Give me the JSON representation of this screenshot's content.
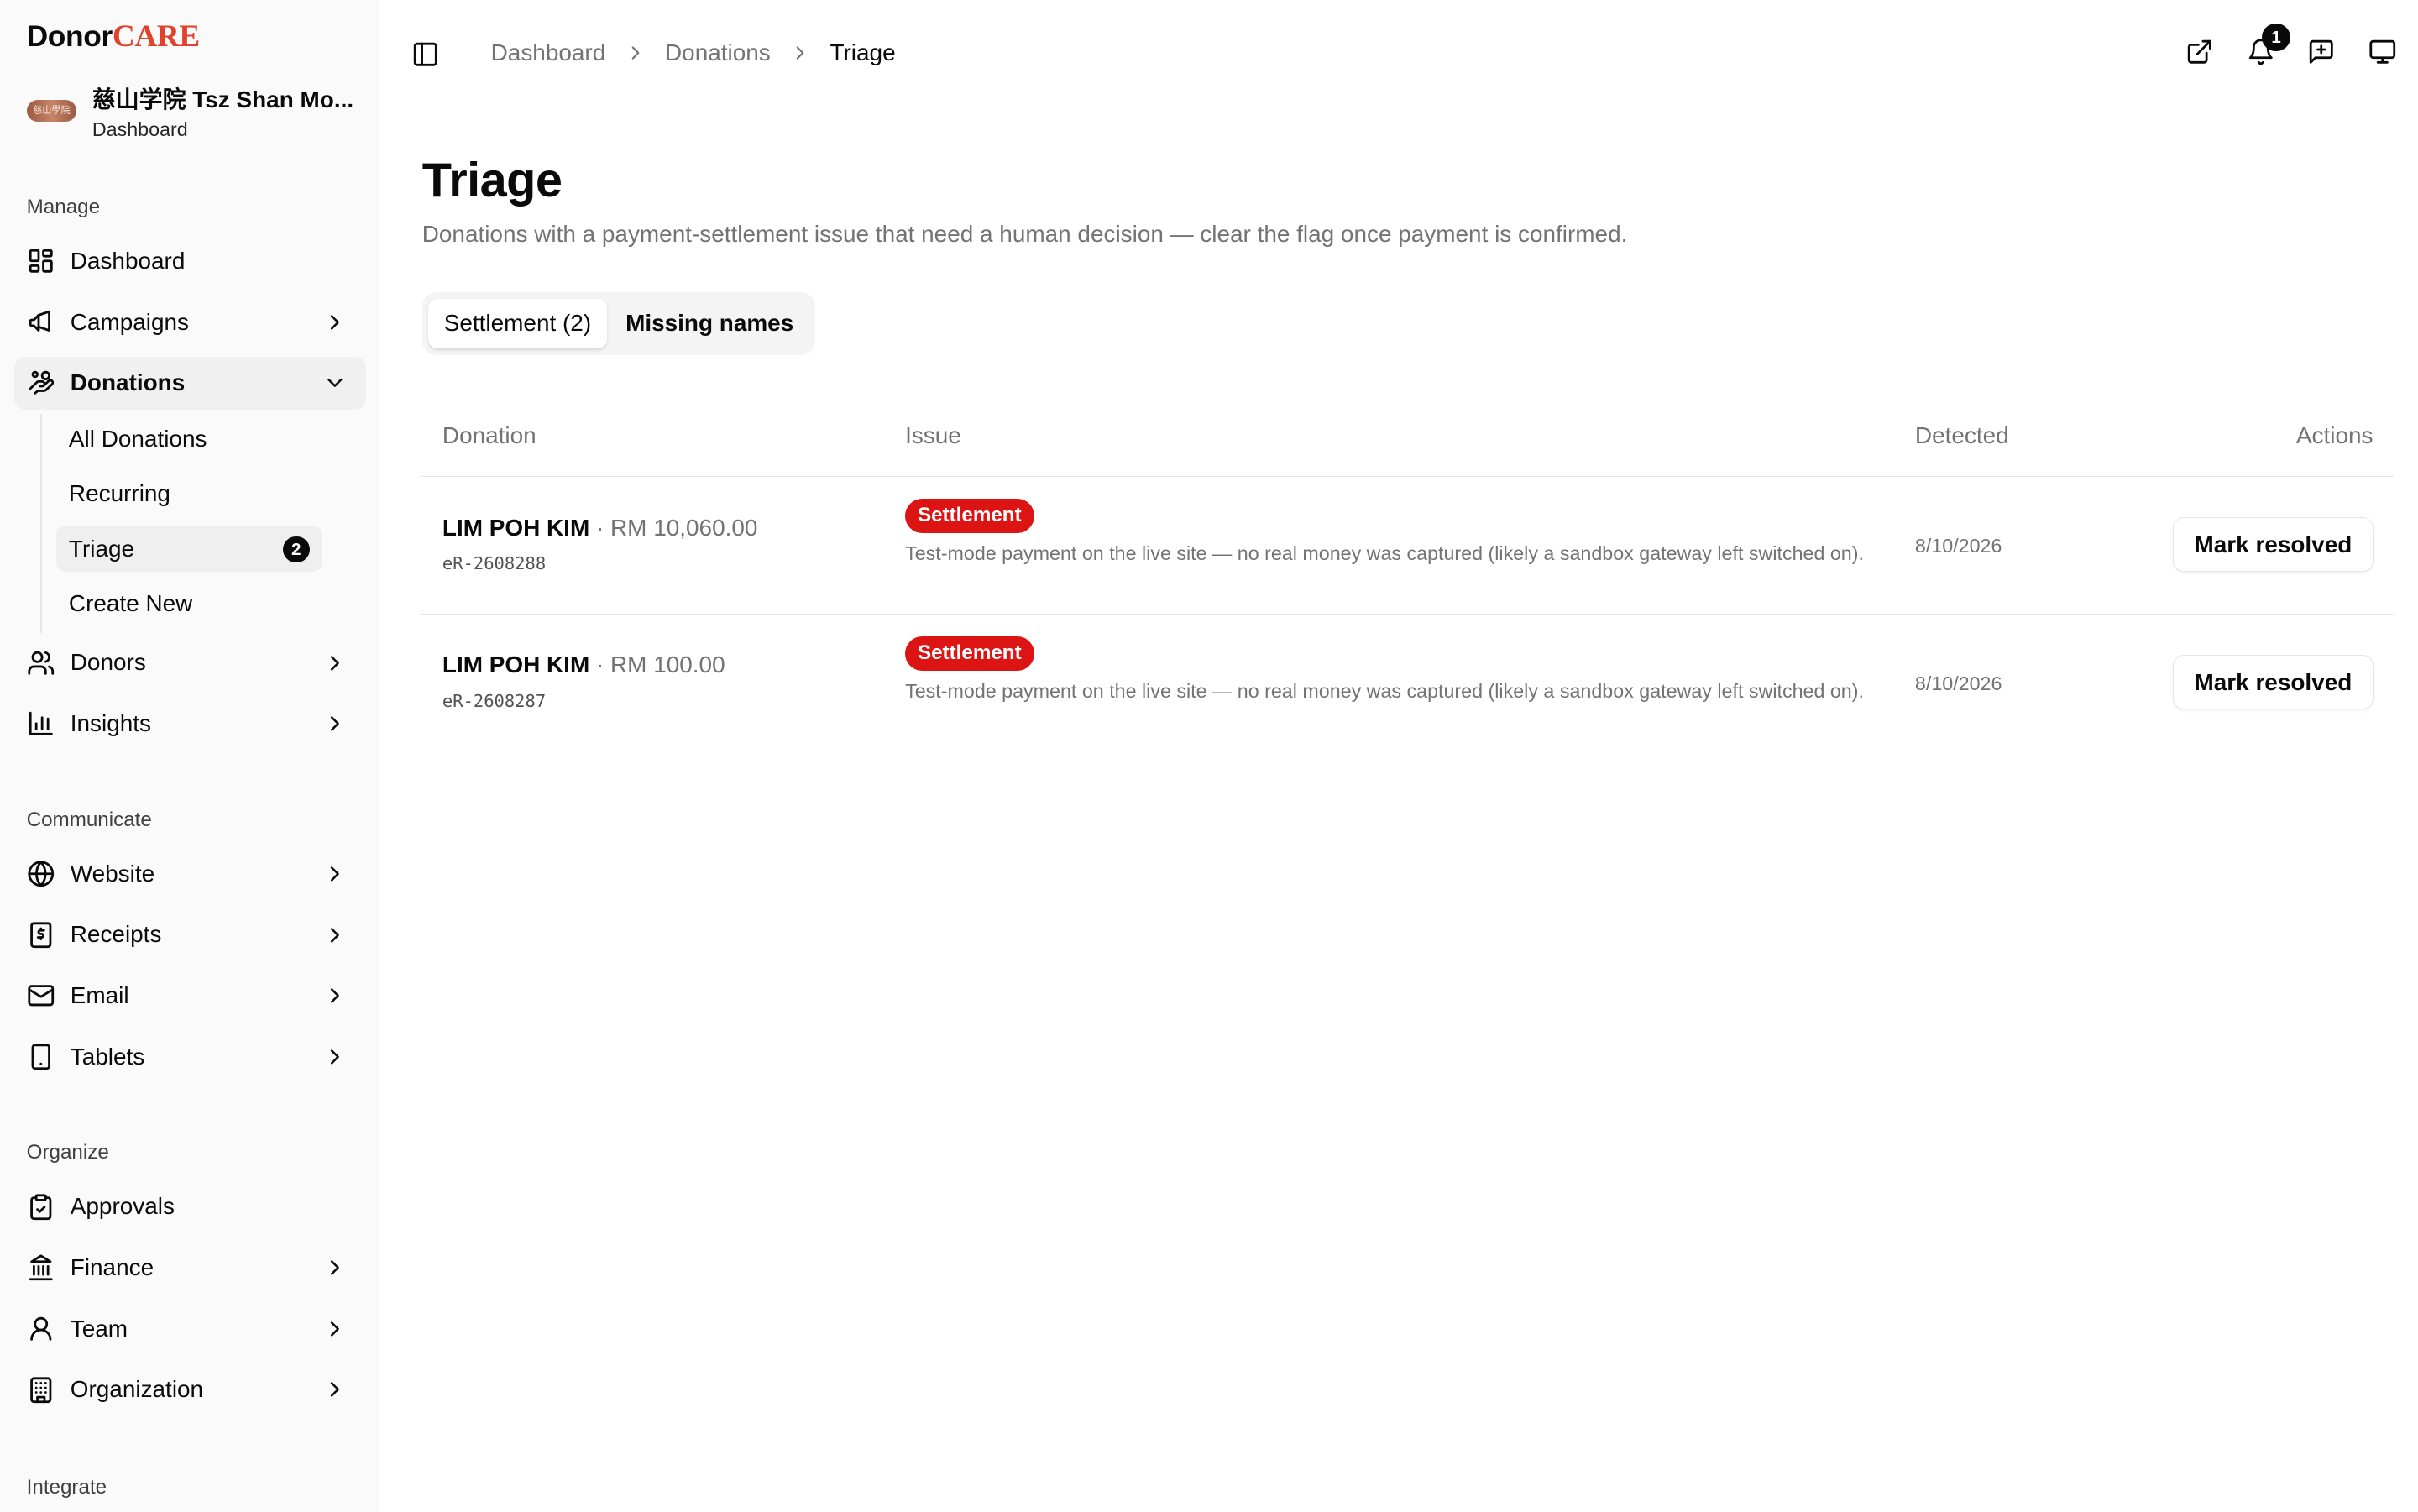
{
  "brand": {
    "part1": "Donor",
    "part2": "CARE",
    "accent": "#e0432b"
  },
  "org": {
    "name": "慈山学院 Tsz Shan Mo...",
    "subtitle": "Dashboard",
    "avatar_text": "慈山學院"
  },
  "sidebar": {
    "sections": {
      "manage": "Manage",
      "communicate": "Communicate",
      "organize": "Organize",
      "integrate": "Integrate"
    },
    "items": {
      "dashboard": "Dashboard",
      "campaigns": "Campaigns",
      "donations": "Donations",
      "donors": "Donors",
      "insights": "Insights",
      "website": "Website",
      "receipts": "Receipts",
      "email": "Email",
      "tablets": "Tablets",
      "approvals": "Approvals",
      "finance": "Finance",
      "team": "Team",
      "organization": "Organization"
    },
    "donations_sub": {
      "all": "All Donations",
      "recurring": "Recurring",
      "triage": "Triage",
      "triage_count": "2",
      "create": "Create New"
    }
  },
  "breadcrumb": {
    "first": "Dashboard",
    "second": "Donations",
    "current": "Triage"
  },
  "notifications_count": "1",
  "page": {
    "title": "Triage",
    "description": "Donations with a payment-settlement issue that need a human decision — clear the flag once payment is confirmed."
  },
  "tabs": {
    "settlement": "Settlement (2)",
    "missing_names": "Missing names"
  },
  "table": {
    "headers": {
      "donation": "Donation",
      "issue": "Issue",
      "detected": "Detected",
      "actions": "Actions"
    },
    "rows": [
      {
        "donor": "LIM POH KIM",
        "amount": " · RM 10,060.00",
        "ref": "eR-2608288",
        "issue_badge": "Settlement",
        "issue_text": "Test-mode payment on the live site — no real money was captured (likely a sandbox gateway left switched on).",
        "detected": "8/10/2026",
        "action": "Mark resolved"
      },
      {
        "donor": "LIM POH KIM",
        "amount": " · RM 100.00",
        "ref": "eR-2608287",
        "issue_badge": "Settlement",
        "issue_text": "Test-mode payment on the live site — no real money was captured (likely a sandbox gateway left switched on).",
        "detected": "8/10/2026",
        "action": "Mark resolved"
      }
    ]
  }
}
